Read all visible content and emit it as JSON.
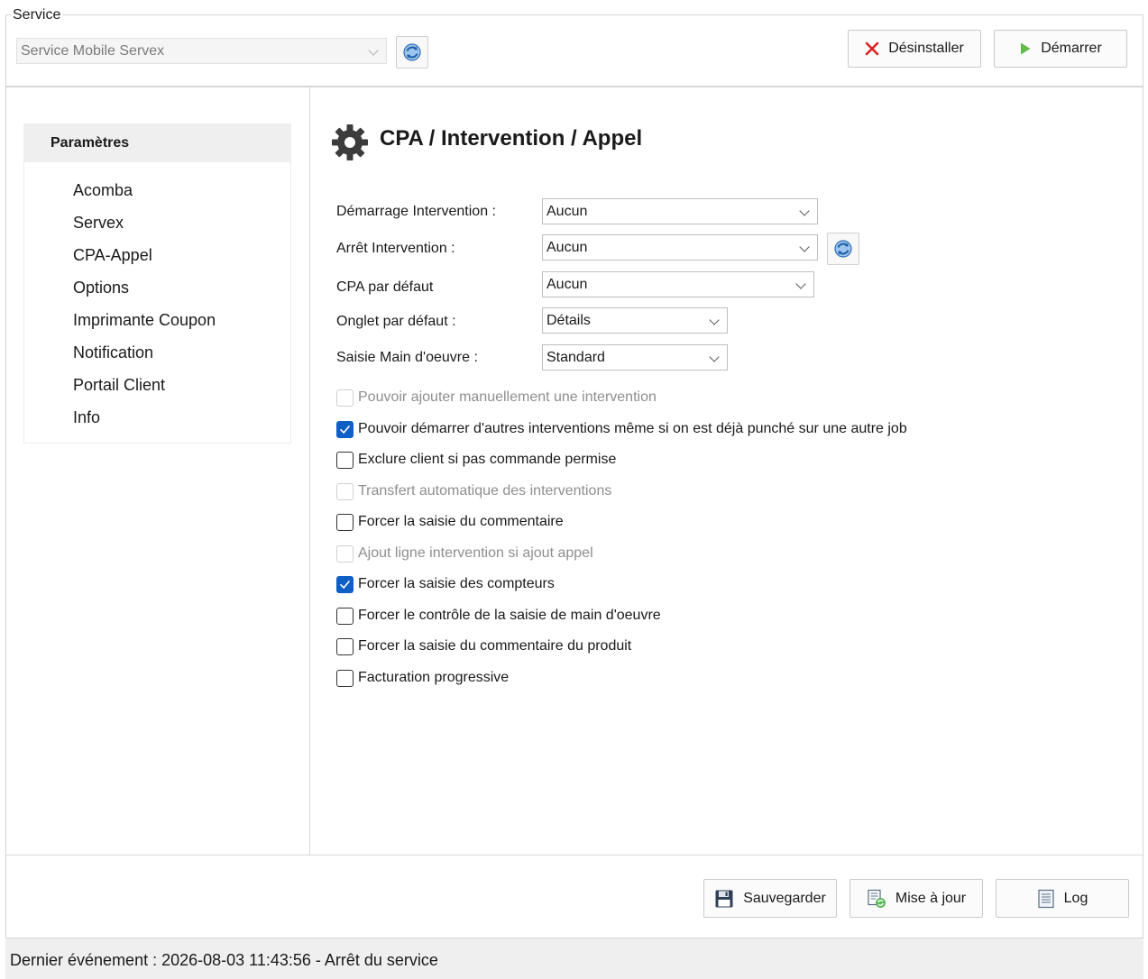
{
  "service": {
    "group_label": "Service",
    "selected": "Service Mobile Servex",
    "uninstall_label": "Désinstaller",
    "start_label": "Démarrer"
  },
  "sidebar": {
    "header": "Paramètres",
    "items": [
      {
        "label": "Acomba"
      },
      {
        "label": "Servex"
      },
      {
        "label": "CPA-Appel"
      },
      {
        "label": "Options"
      },
      {
        "label": "Imprimante Coupon"
      },
      {
        "label": "Notification"
      },
      {
        "label": "Portail Client"
      },
      {
        "label": "Info"
      }
    ]
  },
  "main": {
    "title": "CPA / Intervention / Appel",
    "fields": {
      "demarrage": {
        "label": "Démarrage Intervention :",
        "value": "Aucun"
      },
      "arret": {
        "label": "Arrêt Intervention :",
        "value": "Aucun"
      },
      "cpa": {
        "label": "CPA par défaut",
        "value": "Aucun"
      },
      "onglet": {
        "label": "Onglet par défaut :",
        "value": "Détails"
      },
      "saisie": {
        "label": "Saisie Main d'oeuvre :",
        "value": "Standard"
      }
    },
    "checkboxes": [
      {
        "label": "Pouvoir ajouter manuellement  une intervention",
        "checked": false,
        "disabled": true
      },
      {
        "label": "Pouvoir démarrer d'autres interventions même si on est déjà punché sur une autre job",
        "checked": true,
        "disabled": false
      },
      {
        "label": "Exclure client si pas commande permise",
        "checked": false,
        "disabled": false
      },
      {
        "label": "Transfert automatique des interventions",
        "checked": false,
        "disabled": true
      },
      {
        "label": "Forcer la saisie du commentaire",
        "checked": false,
        "disabled": false
      },
      {
        "label": "Ajout ligne intervention si ajout appel",
        "checked": false,
        "disabled": true
      },
      {
        "label": "Forcer la saisie des compteurs",
        "checked": true,
        "disabled": false
      },
      {
        "label": "Forcer le contrôle de la saisie de main d'oeuvre",
        "checked": false,
        "disabled": false
      },
      {
        "label": "Forcer la saisie du commentaire du produit",
        "checked": false,
        "disabled": false
      },
      {
        "label": "Facturation progressive",
        "checked": false,
        "disabled": false
      }
    ]
  },
  "actions": {
    "save_label": "Sauvegarder",
    "update_label": "Mise à jour",
    "log_label": "Log"
  },
  "status": {
    "text": "Dernier événement : 2026-08-03 11:43:56 - Arrêt du service"
  },
  "colors": {
    "checkbox_checked": "#0f5fc6",
    "uninstall_icon": "#e02020",
    "start_icon": "#62b94a"
  }
}
